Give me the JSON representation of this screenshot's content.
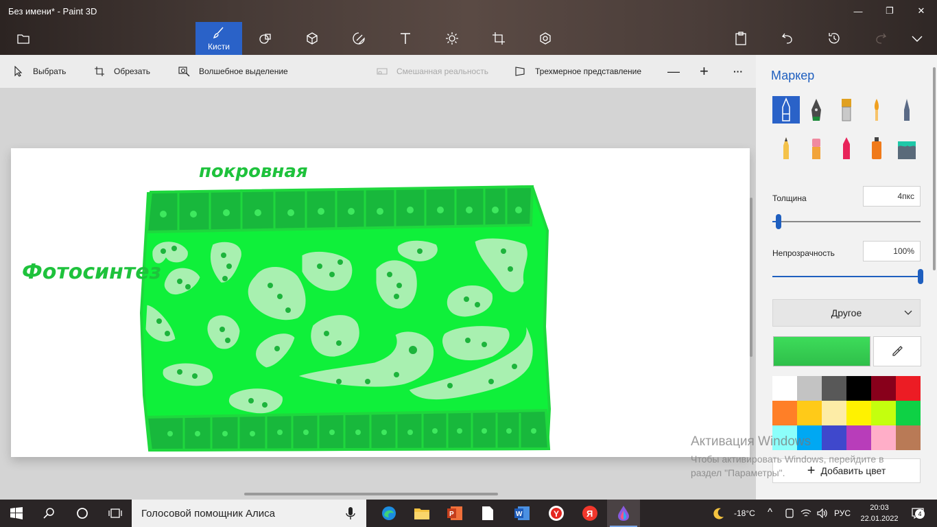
{
  "window": {
    "title": "Без имени* - Paint 3D",
    "controls": {
      "minimize": "—",
      "restore": "❐",
      "close": "✕"
    }
  },
  "toolbar": {
    "menu_icon": "folder-icon",
    "brushes_label": "Кисти",
    "tools": [
      "brushes",
      "2d-shapes",
      "3d-shapes",
      "stickers",
      "text",
      "effects",
      "canvas",
      "3d-library"
    ],
    "right_tools": [
      "paste",
      "undo",
      "history",
      "redo",
      "expand"
    ]
  },
  "subtoolbar": {
    "select": "Выбрать",
    "crop": "Обрезать",
    "magic_select": "Волшебное выделение",
    "mixed_reality": "Смешанная реальность",
    "view_3d": "Трехмерное представление",
    "zoom_out": "—",
    "zoom_in": "+",
    "more": "···"
  },
  "canvas_drawing": {
    "label_top": "покровная",
    "label_left": "Фотосинтез",
    "colors": {
      "outline": "#1ee63a",
      "tissue": "#0ff03a",
      "cells": "#18b83c",
      "chloroplast_cells": "#a8f0b0",
      "dots": "#1db43c"
    }
  },
  "panel": {
    "title": "Маркер",
    "thickness_label": "Толщина",
    "thickness_value": "4пкс",
    "thickness_level": 0.04,
    "opacity_label": "Непрозрачность",
    "opacity_value": "100%",
    "opacity_level": 1.0,
    "dropdown_label": "Другое",
    "add_color_label": "Добавить цвет",
    "current_color": "#2fbf4a",
    "brushes": [
      "marker",
      "calligraphy-pen",
      "oil-brush",
      "watercolor",
      "pixel-pen",
      "pencil",
      "eraser",
      "crayon",
      "spray-can",
      "fill"
    ],
    "palette": [
      "#ffffff",
      "#c3c3c3",
      "#585858",
      "#000000",
      "#88001b",
      "#ec1c24",
      "#ff7f27",
      "#ffca18",
      "#fdeca6",
      "#fff200",
      "#c4ff0e",
      "#0ed145",
      "#8cfffb",
      "#00a8f3",
      "#3f48cc",
      "#b83dba",
      "#ffaec8",
      "#b97a56"
    ]
  },
  "watermark": {
    "line1": "Активация Windows",
    "line2": "Чтобы активировать Windows, перейдите в раздел \"Параметры\"."
  },
  "taskbar": {
    "search_text": "Голосовой помощник Алиса",
    "apps": [
      "edge",
      "file-explorer",
      "powerpoint",
      "notepad",
      "word",
      "yandex-browser",
      "yandex",
      "paint-3d"
    ],
    "weather": "-18°C",
    "language": "РУС",
    "time": "20:03",
    "date": "22.01.2022",
    "notifications": "4"
  }
}
